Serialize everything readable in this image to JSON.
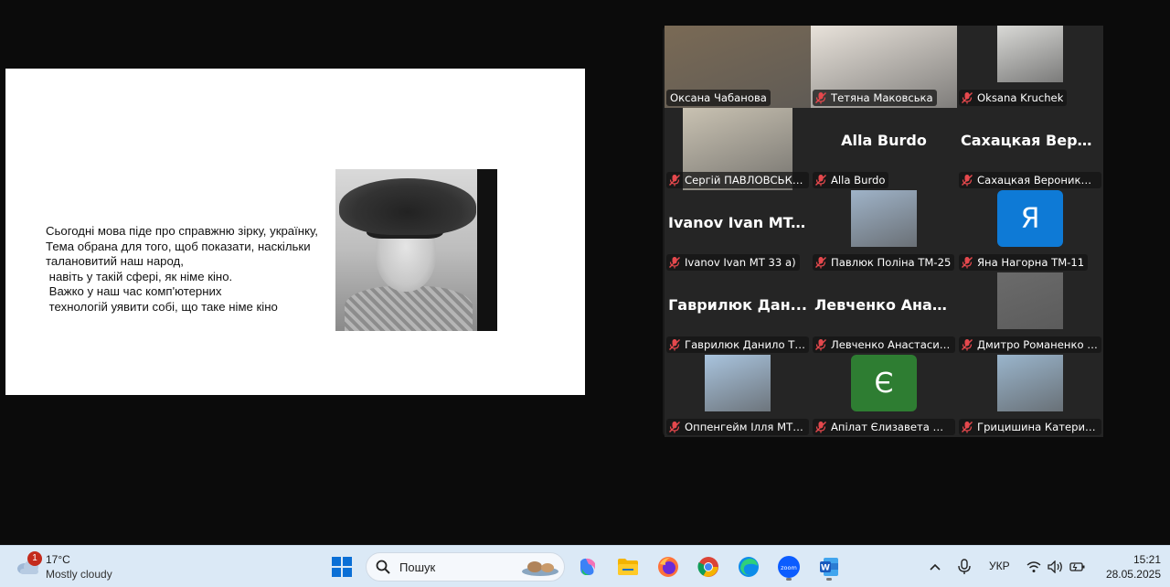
{
  "slide": {
    "lines": [
      "Сьогодні мова піде про справжню зірку, українку,",
      "Тема обрана для того, щоб показати, наскільки",
      "талановитий наш народ,",
      " навіть у такій сфері, як німе кіно.",
      " Важко у наш час комп'ютерних",
      " технологій уявити собі, що таке німе кіно"
    ]
  },
  "participants": [
    {
      "name": "Оксана Чабанова",
      "muted": false,
      "active": true,
      "kind": "video",
      "video_color": "#7a6a55"
    },
    {
      "name": "Тетяна Маковська",
      "muted": true,
      "active": false,
      "kind": "video",
      "video_color": "#e8e2da"
    },
    {
      "name": "Oksana Kruchek",
      "muted": true,
      "active": false,
      "kind": "video",
      "video_color": "#d9d9d6"
    },
    {
      "name": "Сергій ПАВЛОВСЬКИЙ",
      "muted": true,
      "active": false,
      "kind": "video",
      "video_color": "#c9c2b2"
    },
    {
      "name": "Alla Burdo",
      "muted": true,
      "active": false,
      "kind": "text",
      "big": "Alla Burdo"
    },
    {
      "name": "Сахацкая Вероника Т...",
      "muted": true,
      "active": false,
      "kind": "text",
      "big": "Сахацкая Веро..."
    },
    {
      "name": "Ivanov Ivan MT 33 a)",
      "muted": true,
      "active": false,
      "kind": "text",
      "big": "Ivanov Ivan MT..."
    },
    {
      "name": "Павлюк Поліна ТМ-25",
      "muted": true,
      "active": false,
      "kind": "video",
      "video_color": "#9fb3c8"
    },
    {
      "name": "Яна Нагорна ТМ-11",
      "muted": true,
      "active": false,
      "kind": "avatar",
      "avatar_letter": "Я",
      "avatar_color": "#0e7ad6"
    },
    {
      "name": "Гаврилюк Данило ТМ...",
      "muted": true,
      "active": false,
      "kind": "text",
      "big": "Гаврилюк Дан..."
    },
    {
      "name": "Левченко Анастасия ...",
      "muted": true,
      "active": false,
      "kind": "text",
      "big": "Левченко Анас..."
    },
    {
      "name": "Дмитро Романенко Г...",
      "muted": true,
      "active": false,
      "kind": "video",
      "video_color": "#6b6b6b"
    },
    {
      "name": "Оппенгейм Ілля МТс-...",
      "muted": true,
      "active": false,
      "kind": "video",
      "video_color": "#a9c4de"
    },
    {
      "name": "Апілат Єлизавета МТ-...",
      "muted": true,
      "active": false,
      "kind": "avatar",
      "avatar_letter": "Є",
      "avatar_color": "#2e7d32"
    },
    {
      "name": "Грицишина Катерина...",
      "muted": true,
      "active": false,
      "kind": "video",
      "video_color": "#9ab5cc"
    }
  ],
  "taskbar": {
    "weather": {
      "badge": "1",
      "temp": "17°C",
      "condition": "Mostly cloudy"
    },
    "search_placeholder": "Пошук",
    "language": "УКР",
    "time": "15:21",
    "date": "28.05.2025",
    "apps": [
      "windows-start",
      "copilot",
      "file-explorer",
      "firefox",
      "chrome",
      "edge",
      "zoom",
      "word"
    ]
  },
  "colors": {
    "active_speaker": "#2ecc71",
    "mic_muted": "#e5484d",
    "taskbar_bg": "#dbe9f6"
  }
}
